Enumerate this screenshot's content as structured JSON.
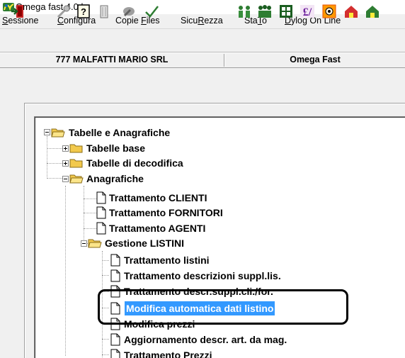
{
  "window": {
    "title": "Omega fast 4.0.b"
  },
  "menu": [
    {
      "pre": "",
      "u": "S",
      "post": "essione"
    },
    {
      "pre": "",
      "u": "C",
      "post": "onfigura"
    },
    {
      "pre": "Copie ",
      "u": "F",
      "post": "iles"
    },
    {
      "pre": "Sicu",
      "u": "R",
      "post": "ezza"
    },
    {
      "pre": "Sta",
      "u": "T",
      "post": "o"
    },
    {
      "pre": "",
      "u": "D",
      "post": "ylog On Line"
    }
  ],
  "toolbar": {
    "icons": [
      "exit-door-icon",
      "tool-icon",
      "help-icon",
      "trash-icon",
      "hammer-icon",
      "checkmark-icon",
      "users-icon",
      "user-group-icon",
      "calculator-icon",
      "currency-icon",
      "money-icon",
      "house-red-icon",
      "house-green-icon"
    ]
  },
  "status": {
    "company": "777 MALFATTI MARIO SRL",
    "product": "Omega Fast"
  },
  "tree": {
    "root": "Tabelle e Anagrafiche",
    "tabelle_base": "Tabelle base",
    "tabelle_decodifica": "Tabelle di decodifica",
    "anagrafiche": "Anagrafiche",
    "clienti": "Trattamento CLIENTI",
    "fornitori": "Trattamento FORNITORI",
    "agenti": "Trattamento AGENTI",
    "gestione_listini": "Gestione LISTINI",
    "listini": "Trattamento listini",
    "descr_suppl": "Trattamento descrizioni suppl.lis.",
    "descr_suppl_cli": "Trattamento descr.suppl.cli./for.",
    "modifica_auto": "Modifica automatica dati listino",
    "modifica_prezzi": "Modifica prezzi",
    "aggiornamento": "Aggiornamento descr. art. da mag.",
    "prezzi": "Trattamento Prezzi"
  },
  "colors": {
    "selection": "#3399ff",
    "folder": "#f2c94c",
    "window_bg": "#f0f0f0"
  }
}
